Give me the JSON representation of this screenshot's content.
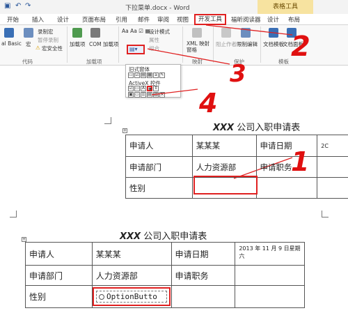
{
  "word": {
    "title": "下拉菜单.docx - Word",
    "table_tools": "表格工具",
    "tabs": [
      "开始",
      "插入",
      "设计",
      "页面布局",
      "引用",
      "邮件",
      "审阅",
      "视图",
      "开发工具",
      "福昕阅读器",
      "设计",
      "布局"
    ],
    "ribbon": {
      "basic_label": "al Basic",
      "macro_label": "宏",
      "record_macro": "录制宏",
      "pause_record": "暂停录制",
      "macro_security": "宏安全性",
      "group_code": "代码",
      "addins_label": "加载项",
      "com_addins": "COM 加载项",
      "group_addins": "加载项",
      "design_mode": "设计模式",
      "properties": "属性",
      "group_combine": "组合",
      "xml_mapping": "XML 映射窗格",
      "group_mapping": "映射",
      "block_authors": "阻止作者",
      "restrict_editing": "限制编辑",
      "group_protect": "保护",
      "doc_template": "文档模板",
      "doc_panel": "文档面板",
      "group_templates": "模板"
    },
    "dropdown": {
      "legacy_header": "旧式窗体",
      "activex_header": "ActiveX 控件"
    }
  },
  "doc1": {
    "title_italic": "XXX",
    "title_rest": " 公司入职申请表",
    "rows": [
      [
        "申请人",
        "某某某",
        "申请日期",
        "2C"
      ],
      [
        "申请部门",
        "人力资源部",
        "申请职务",
        ""
      ],
      [
        "性别",
        "",
        "",
        ""
      ]
    ]
  },
  "doc2": {
    "title_italic": "XXX",
    "title_rest": " 公司入职申请表",
    "rows": [
      [
        "申请人",
        "某某某",
        "申请日期",
        "2013 年 11 月 9 日星期六"
      ],
      [
        "申请部门",
        "人力资源部",
        "申请职务",
        ""
      ],
      [
        "性别",
        "OptionButto",
        "",
        ""
      ]
    ]
  },
  "annotations": [
    "1",
    "2",
    "3",
    "4"
  ],
  "colors": {
    "accent_red": "#e02020",
    "word_blue": "#2b579a"
  }
}
